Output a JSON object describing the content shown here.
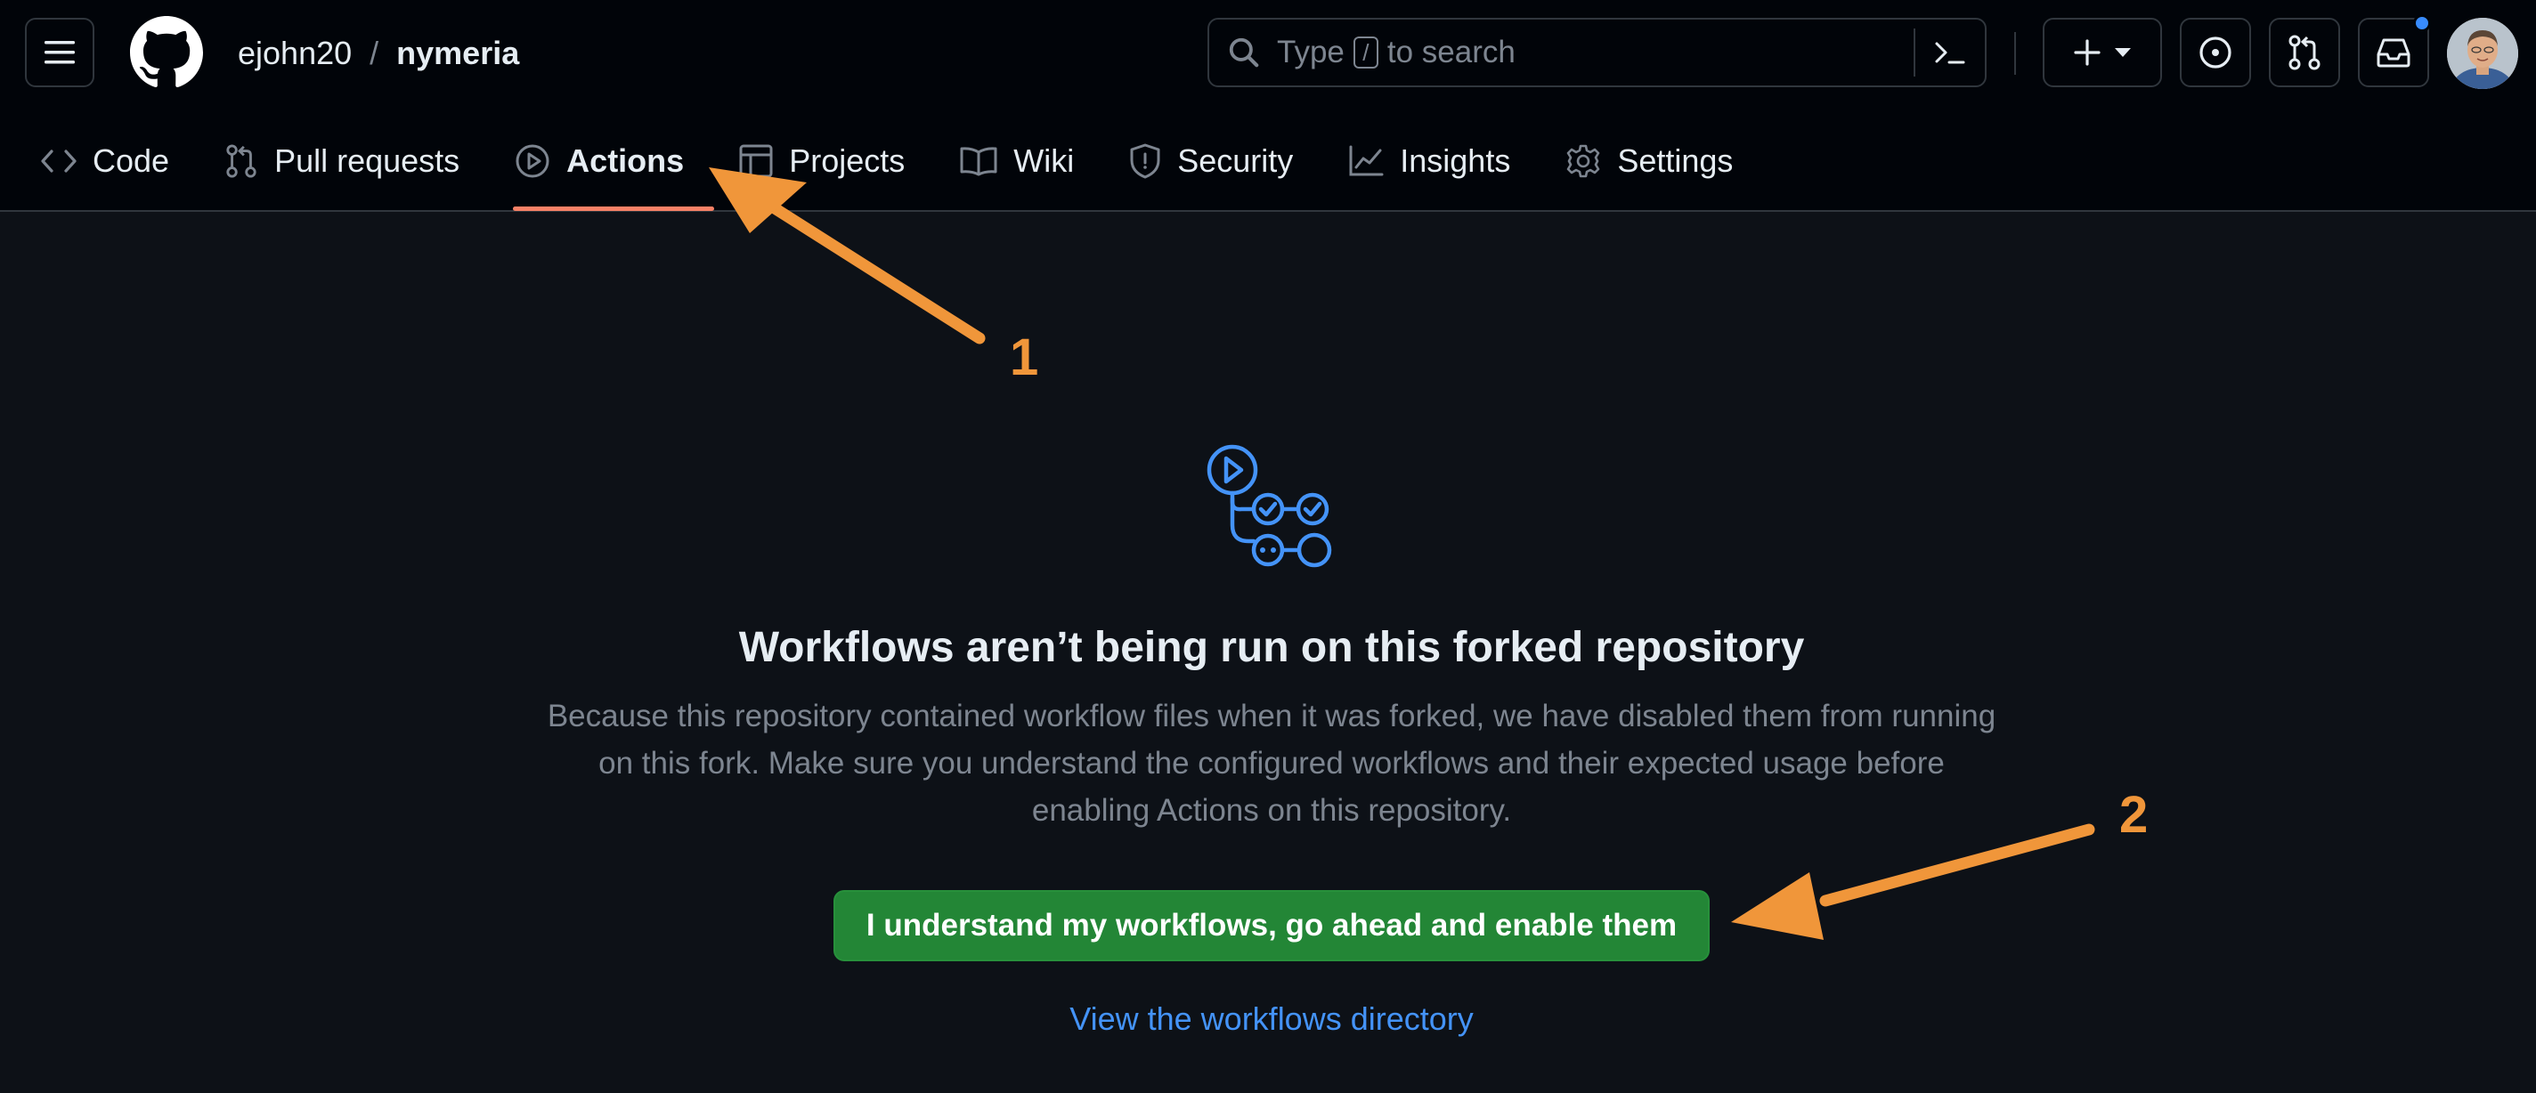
{
  "header": {
    "owner": "ejohn20",
    "separator": "/",
    "repo": "nymeria",
    "search_prefix": "Type",
    "search_key": "/",
    "search_suffix": "to search"
  },
  "tabs": [
    {
      "label": "Code",
      "icon": "code-icon"
    },
    {
      "label": "Pull requests",
      "icon": "git-pull-request-icon"
    },
    {
      "label": "Actions",
      "icon": "play-icon",
      "active": true
    },
    {
      "label": "Projects",
      "icon": "table-icon"
    },
    {
      "label": "Wiki",
      "icon": "book-icon"
    },
    {
      "label": "Security",
      "icon": "shield-icon"
    },
    {
      "label": "Insights",
      "icon": "graph-icon"
    },
    {
      "label": "Settings",
      "icon": "gear-icon"
    }
  ],
  "main": {
    "title": "Workflows aren’t being run on this forked repository",
    "description_lines": [
      "Because this repository contained workflow files when it was forked, we have disabled them from running",
      "on this fork. Make sure you understand the configured workflows and their expected usage before",
      "enabling Actions on this repository."
    ],
    "enable_button": "I understand my workflows, go ahead and enable them",
    "directory_link": "View the workflows directory"
  },
  "annotations": {
    "marker_1": "1",
    "marker_2": "2",
    "color": "#f0963a"
  },
  "colors": {
    "background": "#0d1117",
    "header": "#010409",
    "accent_blue": "#4493f8",
    "button_green": "#238636",
    "tab_underline": "#f78166"
  }
}
